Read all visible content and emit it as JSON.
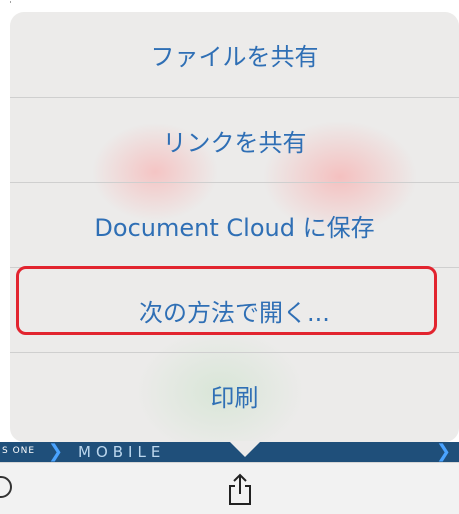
{
  "share_sheet": {
    "items": [
      {
        "label": "ファイルを共有"
      },
      {
        "label": "リンクを共有"
      },
      {
        "label": "Document Cloud に保存"
      },
      {
        "label": "次の方法で開く..."
      },
      {
        "label": "印刷"
      }
    ],
    "text_color": "#2f6fb5",
    "highlight_color": "#e2242f"
  },
  "background_banner": {
    "left_text": "S ONE",
    "center_text": "MOBILE"
  },
  "toolbar": {
    "icons": [
      "circle-icon",
      "share-icon"
    ]
  }
}
